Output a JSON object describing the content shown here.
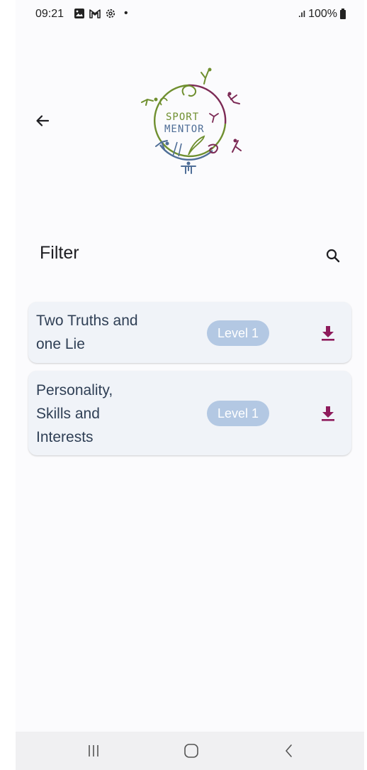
{
  "status_bar": {
    "time": "09:21",
    "dot": "•",
    "signal": ".ıl",
    "battery_percent": "100%"
  },
  "header": {
    "logo": {
      "line1": "SPORT",
      "line2": "MENTOR"
    }
  },
  "filter": {
    "title": "Filter"
  },
  "items": [
    {
      "title_lines": [
        "Two Truths and",
        "one Lie"
      ],
      "level": "Level 1"
    },
    {
      "title_lines": [
        "Personality,",
        "Skills and",
        "Interests"
      ],
      "level": "Level 1"
    }
  ],
  "colors": {
    "accent": "#8e1b5c",
    "badge_bg": "#b3c8e3",
    "card_bg": "#f0f3f8",
    "title_text": "#2f3f55",
    "logo_green": "#6f8f2f",
    "logo_blue": "#4f6e97",
    "logo_purple": "#7c2a55"
  },
  "icons": {
    "back": "arrow-left-icon",
    "search": "search-icon",
    "download": "download-icon",
    "nav_recent": "recent-apps-icon",
    "nav_home": "home-icon",
    "nav_back": "chevron-left-icon"
  }
}
